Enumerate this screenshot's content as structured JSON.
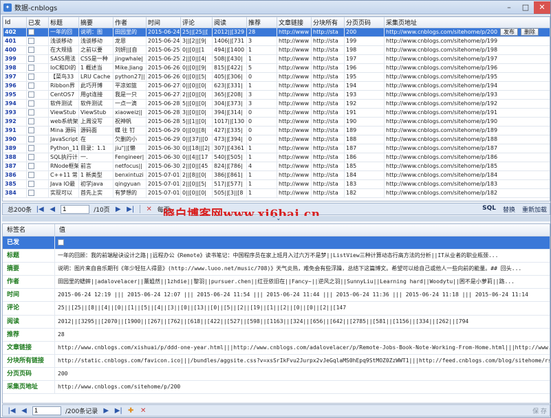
{
  "window": {
    "title": "数据-cnblogs"
  },
  "grid": {
    "columns": [
      "Id",
      "已发",
      "标题",
      "摘要",
      "作者",
      "时间",
      "评论",
      "阅读",
      "推荐",
      "文章链接",
      "分块所有",
      "分页页码",
      "采集页地址"
    ],
    "rows": [
      {
        "id": "402",
        "title": "一年的回",
        "summary": "说明：图",
        "author": "田园里的",
        "time": "2015-06-24",
        "comments": "25||[25||[",
        "reads": "2012||[329",
        "rec": "28",
        "link": "http://www",
        "chunk": "http://sta",
        "page": "200",
        "url": "http://www.cnblogs.com/sitehome/p/200",
        "selected": true
      },
      {
        "id": "401",
        "title": "浅谈移动",
        "summary": "浅谈移动",
        "author": "龙恩",
        "time": "2015-06-24",
        "comments": "3||[2||[9|",
        "reads": "1406||[731",
        "rec": "3",
        "link": "http://www",
        "chunk": "http://sta",
        "page": "199",
        "url": "http://www.cnblogs.com/sitehome/p/199"
      },
      {
        "id": "400",
        "title": "在大规插",
        "summary": "之前以要",
        "author": "刘妍||[自",
        "time": "2015-06-25",
        "comments": "0||[0||[1",
        "reads": "494||[1400",
        "rec": "1",
        "link": "http://www",
        "chunk": "http://sta",
        "page": "198",
        "url": "http://www.cnblogs.com/sitehome/p/198"
      },
      {
        "id": "399",
        "title": "SASS用法",
        "summary": "CSS是一种",
        "author": "jingwhale|",
        "time": "2015-06-25",
        "comments": "2||[0||[4|",
        "reads": "508||[430|",
        "rec": "1",
        "link": "http://www",
        "chunk": "http://sta",
        "page": "197",
        "url": "http://www.cnblogs.com/sitehome/p/197"
      },
      {
        "id": "398",
        "title": "IoC和DI的",
        "summary": "1 概述当",
        "author": "Mike.Jiang",
        "time": "2015-06-26",
        "comments": "0||[0||[9|",
        "reads": "815||[422|",
        "rec": "5",
        "link": "http://www",
        "chunk": "http://sta",
        "page": "196",
        "url": "http://www.cnblogs.com/sitehome/p/196"
      },
      {
        "id": "397",
        "title": "【菜鸟33",
        "summary": "LRU Cache",
        "author": "python27||",
        "time": "2015-06-26",
        "comments": "0||[0||[5|",
        "reads": "405||[306|",
        "rec": "0",
        "link": "http://www",
        "chunk": "http://sta",
        "page": "195",
        "url": "http://www.cnblogs.com/sitehome/p/195"
      },
      {
        "id": "396",
        "title": "Ribbon界",
        "summary": "此巧开博",
        "author": "平凉如篮",
        "time": "2015-06-27",
        "comments": "0||[0||[0|",
        "reads": "623||[331|",
        "rec": "1",
        "link": "http://www",
        "chunk": "http://sta",
        "page": "194",
        "url": "http://www.cnblogs.com/sitehome/p/194"
      },
      {
        "id": "395",
        "title": "CentOS7",
        "summary": "用gt连接",
        "author": "我是一只",
        "time": "2015-06-27",
        "comments": "2||[0||[0|",
        "reads": "365||[208|",
        "rec": "3",
        "link": "http://www",
        "chunk": "http://sta",
        "page": "193",
        "url": "http://www.cnblogs.com/sitehome/p/193"
      },
      {
        "id": "394",
        "title": "软件测试",
        "summary": "软件测试",
        "author": "一点一滴",
        "time": "2015-06-28",
        "comments": "5||[0||[0|",
        "reads": "304||[373|",
        "rec": "3",
        "link": "http://www",
        "chunk": "http://sta",
        "page": "192",
        "url": "http://www.cnblogs.com/sitehome/p/192"
      },
      {
        "id": "393",
        "title": "ViewStub",
        "summary": "ViewStub",
        "author": "xiaoweiz||",
        "time": "2015-06-28",
        "comments": "3||[0||[0|",
        "reads": "394||[314|",
        "rec": "0",
        "link": "http://www",
        "chunk": "http://sta",
        "page": "191",
        "url": "http://www.cnblogs.com/sitehome/p/191"
      },
      {
        "id": "392",
        "title": "web系统架",
        "summary": "上周没写",
        "author": "祝神帆",
        "time": "2015-06-28",
        "comments": "5||[1||[0|",
        "reads": "1017||[130",
        "rec": "0",
        "link": "http://www",
        "chunk": "http://sta",
        "page": "190",
        "url": "http://www.cnblogs.com/sitehome/p/190"
      },
      {
        "id": "391",
        "title": "Mina 源码",
        "summary": "源码面",
        "author": "蝶 往 钉",
        "time": "2015-06-29",
        "comments": "0||[0||[8|",
        "reads": "427||[335|",
        "rec": "0",
        "link": "http://www",
        "chunk": "http://sta",
        "page": "189",
        "url": "http://www.cnblogs.com/sitehome/p/189"
      },
      {
        "id": "390",
        "title": "JavaScript",
        "summary": "在",
        "author": "欠删的小",
        "time": "2015-06-29",
        "comments": "0||[37||[0",
        "reads": "473||[394|",
        "rec": "0",
        "link": "http://www",
        "chunk": "http://sta",
        "page": "188",
        "url": "http://www.cnblogs.com/sitehome/p/188"
      },
      {
        "id": "389",
        "title": "Python_11-",
        "summary": "目录：1.1",
        "author": "jiu\"||[懒",
        "time": "2015-06-30",
        "comments": "0||[18||[2|",
        "reads": "307||[4361",
        "rec": "1",
        "link": "http://www",
        "chunk": "http://sta",
        "page": "187",
        "url": "http://www.cnblogs.com/sitehome/p/187"
      },
      {
        "id": "388",
        "title": "SQL执行计",
        "summary": "一.",
        "author": "Fengineer|",
        "time": "2015-06-30",
        "comments": "0||[4||[17",
        "reads": "540||[505|",
        "rec": "1",
        "link": "http://www",
        "chunk": "http://sta",
        "page": "186",
        "url": "http://www.cnblogs.com/sitehome/p/186"
      },
      {
        "id": "387",
        "title": "RNode框架",
        "summary": "前言",
        "author": "netfocus||",
        "time": "2015-06-30",
        "comments": "2||[0||[45",
        "reads": "824||[786|",
        "rec": "4",
        "link": "http://www",
        "chunk": "http://sta",
        "page": "185",
        "url": "http://www.cnblogs.com/sitehome/p/185"
      },
      {
        "id": "386",
        "title": "C++11 常",
        "summary": "1 新类型",
        "author": "benxintuzi",
        "time": "2015-07-01",
        "comments": "2||[8||[0|",
        "reads": "386||[861|",
        "rec": "1",
        "link": "http://www",
        "chunk": "http://sta",
        "page": "184",
        "url": "http://www.cnblogs.com/sitehome/p/184"
      },
      {
        "id": "385",
        "title": "Java IO最",
        "summary": "初学java",
        "author": "qingyuan",
        "time": "2015-07-01",
        "comments": "2||[0||[5|",
        "reads": "517||[577|",
        "rec": "1",
        "link": "http://www",
        "chunk": "http://sta",
        "page": "183",
        "url": "http://www.cnblogs.com/sitehome/p/183"
      },
      {
        "id": "384",
        "title": "实现可以",
        "summary": "首先上实",
        "author": "有梦想的",
        "time": "2015-07-01",
        "comments": "0||[0||[0|",
        "reads": "505||[3||[8",
        "rec": "1",
        "link": "http://www",
        "chunk": "http://sta",
        "page": "182",
        "url": "http://www.cnblogs.com/sitehome/p/182"
      }
    ],
    "publish_label": "发布",
    "delete_label": "删除"
  },
  "nav_top": {
    "total": "总200条",
    "page": "1",
    "pages": "/10页",
    "per_page": "每页:",
    "sql": "SQL",
    "replace": "替换",
    "reload": "重新加载"
  },
  "watermark": "晓白博客网www.xi6bai.cn",
  "detail": {
    "headers": [
      "标签名",
      "值"
    ],
    "rows": [
      {
        "key": "已发",
        "value": ""
      },
      {
        "key": "标题",
        "value": "一年的回顾：我的前端秘诀设计之路||远程办公《Remote》读书笔记：中国程序员在家上班月入过六万不是梦||ListView三种计算动态行高方法的分析||IT从业者的职业瓶颈..."
      },
      {
        "key": "摘要",
        "value": "说明：图片来自音乐期刊《年少轻狂人得意》(http://www.luoo.net/music/708)》天气炎热，难免会有些浮躁，总结下这篇博文。希望可以给自己或他人一些向前的能量。## 回头..."
      },
      {
        "key": "作者",
        "value": "田园里的蟋蟀||adalovelacer||薰姐然||1zhdie||黎羽||pursuer.chen||红豆依旧在||Fancy~||逆风之羽||SunnyLiu||Learning hard||Woodytu||困不是小萝莉||路..."
      },
      {
        "key": "时间",
        "value": "2015-06-24 12:19    |||  2015-06-24 12:07     |||  2015-06-24 11:54     |||  2015-06-24 11:44     |||  2015-06-24 11:36     |||  2015-06-24 11:18     |||  2015-06-24 11:14"
      },
      {
        "key": "评论",
        "value": "25||[25||[8||[4||[0||[1||[5||[4||[3||[0||[13||[0||[5||[2||[19||[1||[2||[0||[0||[2||[147"
      },
      {
        "key": "阅读",
        "value": "2012||[3295||[2070||[1900||[267||[762||[618||[422||[527||[598||[1163||[324||[656||[642||[2785||[581||[1156||[334||[262||[794"
      },
      {
        "key": "推荐",
        "value": "28"
      },
      {
        "key": "文章链接",
        "value": "http://www.cnblogs.com/xishuai/p/ddd-one-year.html|||http://www.cnblogs.com/adalovelacer/p/Remote-Jobs-Book-Note-Working-From-Home.html|||http://www.cnblogs.c..."
      },
      {
        "key": "分块所有链接",
        "value": "http://static.cnblogs.com/favicon.ico|||/bundles/aggsite.css?v=xsSrIkFvu2Jurpx2vJeGqlaMS0hEpq9StMOZ0ZzWWT1|||http://feed.cnblogs.com/blog/sitehome/rss|||http..."
      },
      {
        "key": "分页页码",
        "value": "200"
      },
      {
        "key": "采集页地址",
        "value": "http://www.cnblogs.com/sitehome/p/200"
      }
    ]
  },
  "nav_bottom": {
    "page": "1",
    "total": "/200条记录",
    "save": "保 存"
  }
}
